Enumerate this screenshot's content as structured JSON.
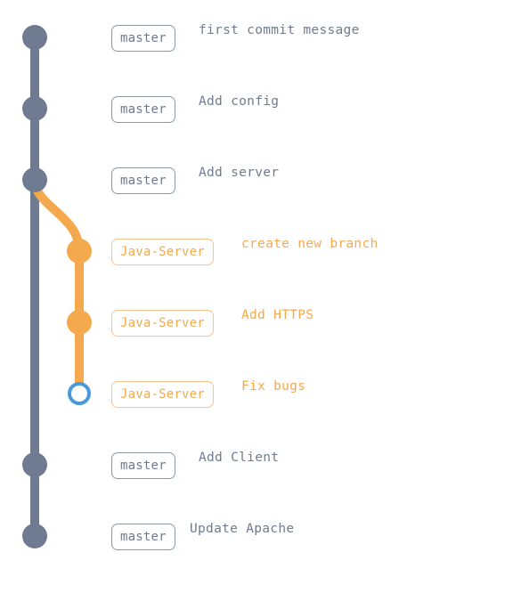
{
  "colors": {
    "master": "#6e7b91",
    "branch": "#f5a94f",
    "head": "#4a9ad9"
  },
  "branches": {
    "master": "master",
    "feature": "Java-Server"
  },
  "commits": [
    {
      "branch": "master",
      "label": "master",
      "message": "first commit message",
      "head": false
    },
    {
      "branch": "master",
      "label": "master",
      "message": "Add config",
      "head": false
    },
    {
      "branch": "master",
      "label": "master",
      "message": "Add server",
      "head": false
    },
    {
      "branch": "feature",
      "label": "Java-Server",
      "message": "create new branch",
      "head": false
    },
    {
      "branch": "feature",
      "label": "Java-Server",
      "message": "Add HTTPS",
      "head": false
    },
    {
      "branch": "feature",
      "label": "Java-Server",
      "message": "Fix bugs",
      "head": true
    },
    {
      "branch": "master",
      "label": "master",
      "message": "Add Client",
      "head": false
    },
    {
      "branch": "master",
      "label": "master",
      "message": "Update Apache",
      "head": false
    }
  ]
}
